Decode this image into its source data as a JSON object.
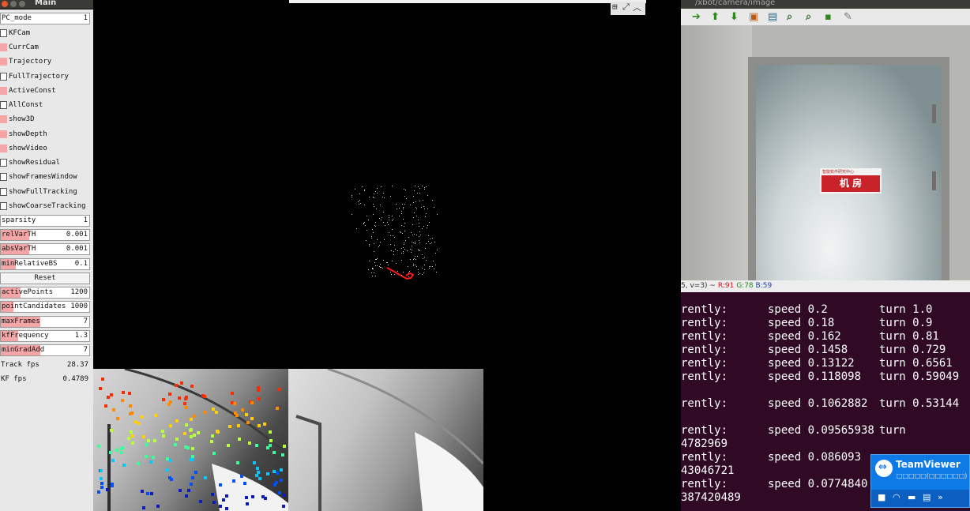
{
  "main_window": {
    "title": "Main"
  },
  "panel": {
    "pc_mode": {
      "label": "PC_mode",
      "value": "1"
    },
    "checkboxes": [
      {
        "label": "KFCam",
        "checked": false
      },
      {
        "label": "CurrCam",
        "checked": true
      },
      {
        "label": "Trajectory",
        "checked": true
      },
      {
        "label": "FullTrajectory",
        "checked": false
      },
      {
        "label": "ActiveConst",
        "checked": true
      },
      {
        "label": "AllConst",
        "checked": false
      },
      {
        "label": "show3D",
        "checked": true
      },
      {
        "label": "showDepth",
        "checked": true
      },
      {
        "label": "showVideo",
        "checked": true
      },
      {
        "label": "showResidual",
        "checked": false
      },
      {
        "label": "showFramesWindow",
        "checked": false
      },
      {
        "label": "showFullTracking",
        "checked": false
      },
      {
        "label": "showCoarseTracking",
        "checked": false
      }
    ],
    "sparsity": {
      "label": "sparsity",
      "value": "1"
    },
    "sliders_a": [
      {
        "label": "relVarTH",
        "value": "0.001",
        "fill": 0.32
      },
      {
        "label": "absVarTH",
        "value": "0.001",
        "fill": 0.32
      },
      {
        "label": "minRelativeBS",
        "value": "0.1",
        "fill": 0.17
      }
    ],
    "reset_label": "Reset",
    "sliders_b": [
      {
        "label": "activePoints",
        "value": "1200",
        "fill": 0.22
      },
      {
        "label": "pointCandidates",
        "value": "1000",
        "fill": 0.14
      },
      {
        "label": "maxFrames",
        "value": "7",
        "fill": 0.45
      },
      {
        "label": "kfFrequency",
        "value": "1.3",
        "fill": 0.2
      },
      {
        "label": "minGradAdd",
        "value": "7",
        "fill": 0.45
      }
    ],
    "stats": [
      {
        "label": "Track fps",
        "value": "28.37"
      },
      {
        "label": "KF fps",
        "value": "0.4789"
      }
    ]
  },
  "camera_window": {
    "title": "/xbot/camera/image",
    "status_prefix": "5, v=3) ~",
    "status_r": "R:91",
    "status_g": "G:78",
    "status_b": "B:59",
    "sign_small": "智能软件研究中心",
    "sign_text": "机 房"
  },
  "terminal": {
    "lines": [
      {
        "a": "rently:",
        "b": "speed 0.2",
        "c": "turn 1.0"
      },
      {
        "a": "rently:",
        "b": "speed 0.18",
        "c": "turn 0.9"
      },
      {
        "a": "rently:",
        "b": "speed 0.162",
        "c": "turn 0.81"
      },
      {
        "a": "rently:",
        "b": "speed 0.1458",
        "c": "turn 0.729"
      },
      {
        "a": "rently:",
        "b": "speed 0.13122",
        "c": "turn 0.6561"
      },
      {
        "a": "rently:",
        "b": "speed 0.118098",
        "c": "turn 0.59049"
      },
      {
        "a": "rently:",
        "b": "speed 0.1062882",
        "c": "turn 0.53144"
      },
      {
        "a": "rently:",
        "b": "speed 0.09565938",
        "c": "turn"
      },
      {
        "a": "4782969",
        "b": "",
        "c": ""
      },
      {
        "a": "rently:",
        "b": "speed 0.086093",
        "c": ""
      },
      {
        "a": "43046721",
        "b": "",
        "c": ""
      },
      {
        "a": "rently:",
        "b": "speed 0.0774840",
        "c": ""
      },
      {
        "a": "387420489",
        "b": "",
        "c": ""
      }
    ]
  },
  "teamviewer": {
    "name": "TeamViewer",
    "sub": "□□□□□(□□□□□□)"
  },
  "colors": {
    "accent": "#f4a6a6",
    "terminal_bg": "#300a24",
    "teamviewer": "#0e7ae6"
  }
}
